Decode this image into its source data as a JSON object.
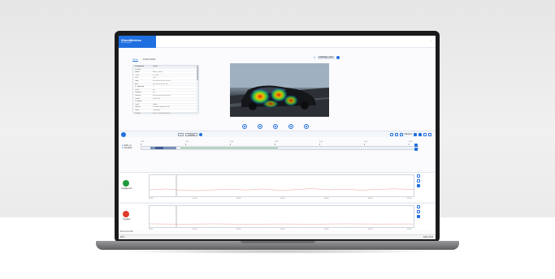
{
  "app": {
    "name": "SilentMetrics",
    "subtitle": "by Devodrive"
  },
  "tabs": [
    "Time",
    "ANNOTATE"
  ],
  "properties": {
    "header": [
      "Parameter",
      "Value"
    ],
    "rows": [
      [
        "▾ Meta",
        "..."
      ],
      [
        "Label",
        "Ev01_clear"
      ],
      [
        "Time",
        "17:480"
      ],
      [
        "Unit",
        "m/s"
      ],
      [
        "Start",
        "00:00:00:00:00:00:00"
      ],
      [
        "End",
        "00:12:34:55:01:02"
      ],
      [
        "▾ Heatmap",
        "..."
      ],
      [
        "Color",
        "jet"
      ],
      [
        "Opacity",
        "0.6"
      ],
      [
        "Source",
        "00:00:00:00:00:00:00"
      ],
      [
        "Offset",
        "00:12:34"
      ],
      [
        "▾ Signal",
        "..."
      ],
      [
        "Type",
        "Road"
      ],
      [
        "Speed",
        "Smooth speed drive"
      ],
      [
        "Lane",
        "Highway"
      ],
      [
        "Frame",
        "0:12 :00:00:00:00:00"
      ]
    ]
  },
  "video": {
    "tag": "Heatmap_view"
  },
  "timeline": {
    "zoom_value": "1",
    "mode": "Original",
    "right_label": "Markers"
  },
  "ruler": [
    "0:00",
    "1:00",
    "2:00",
    "3:00",
    "4:00",
    "5:00",
    "6:00"
  ],
  "track": {
    "label": "Path_ar",
    "sublabel": "Duration"
  },
  "sections": [
    {
      "label": "Engagement",
      "color": "#1e9a3d",
      "axis": [
        "00:00",
        "01:00",
        "02:00",
        "03:00",
        "04:00",
        "05:00",
        "06:00"
      ]
    },
    {
      "label": "Negative",
      "color": "#e03a2c",
      "axis": [
        "00:00",
        "01:00",
        "02:00",
        "03:00",
        "04:00",
        "05:00",
        "06:00"
      ]
    }
  ],
  "status": "Zoom level 100",
  "taskbar": {
    "left": "⊞  Ps",
    "right": "ENG  10:24"
  }
}
